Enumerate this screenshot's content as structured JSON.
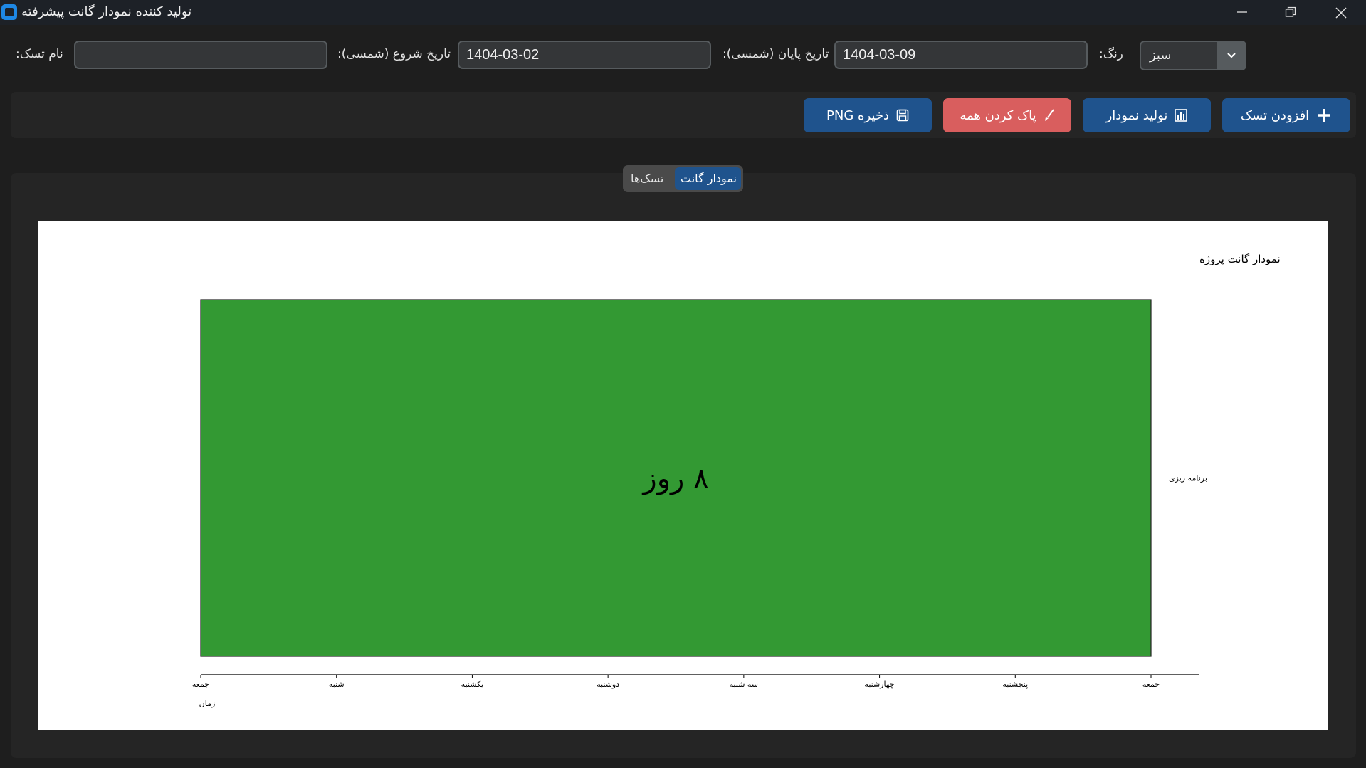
{
  "window": {
    "title": "تولید کننده نمودار گانت پیشرفته"
  },
  "form": {
    "task_name_label": "نام تسک:",
    "task_name_value": "",
    "start_date_label": "تاریخ شروع (شمسی):",
    "start_date_value": "1404-03-02",
    "end_date_label": "تاریخ پایان (شمسی):",
    "end_date_value": "1404-03-09",
    "color_label": "رنگ:",
    "color_value": "سبز"
  },
  "toolbar": {
    "add_task_label": "افزودن تسک",
    "generate_chart_label": "تولید نمودار",
    "clear_all_label": "پاک کردن همه",
    "save_png_label": "ذخیره PNG"
  },
  "tabs": {
    "gantt_label": "نمودار گانت",
    "tasks_label": "تسک‌ها",
    "active": "gantt"
  },
  "colors": {
    "accent_blue": "#1f538d",
    "danger_red": "#d95e5e",
    "bar_green": "#339933"
  },
  "chart_data": {
    "type": "gantt",
    "title": "نمودار گانت پروژه",
    "xlabel": "زمان",
    "ylabel": "",
    "x_ticks": [
      "جمعه",
      "شنبه",
      "یکشنبه",
      "دوشنبه",
      "سه شنبه",
      "چهارشنبه",
      "پنجشنبه",
      "جمعه"
    ],
    "tasks": [
      {
        "name": "برنامه ریزی",
        "start": "1404-03-02",
        "end": "1404-03-09",
        "duration_label": "۸ روز",
        "color": "#339933"
      }
    ],
    "grid": false
  }
}
